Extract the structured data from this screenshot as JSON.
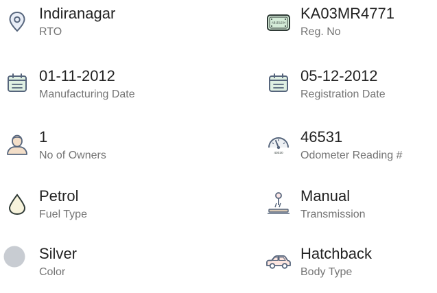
{
  "specs": [
    {
      "value": "Indiranagar",
      "label": "RTO",
      "icon": "location-pin-icon"
    },
    {
      "value": "KA03MR4771",
      "label": "Reg. No",
      "icon": "license-plate-icon",
      "plate_text": "AB1D1234"
    },
    {
      "value": "01-11-2012",
      "label": "Manufacturing Date",
      "icon": "calendar-icon"
    },
    {
      "value": "05-12-2012",
      "label": "Registration Date",
      "icon": "calendar-icon"
    },
    {
      "value": "1",
      "label": "No of Owners",
      "icon": "owner-icon"
    },
    {
      "value": "46531",
      "label": "Odometer Reading #",
      "icon": "odometer-icon",
      "gauge_text": "43020"
    },
    {
      "value": "Petrol",
      "label": "Fuel Type",
      "icon": "fuel-drop-icon"
    },
    {
      "value": "Manual",
      "label": "Transmission",
      "icon": "gear-shift-icon"
    },
    {
      "value": "Silver",
      "label": "Color",
      "icon": "color-swatch-icon",
      "color": "#c8ccd2"
    },
    {
      "value": "Hatchback",
      "label": "Body Type",
      "icon": "car-icon"
    }
  ]
}
